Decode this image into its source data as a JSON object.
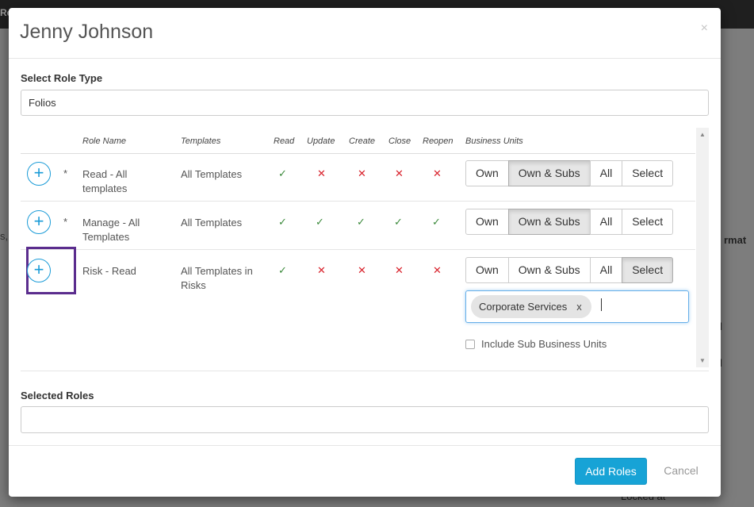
{
  "background": {
    "topbar_text": "Re",
    "fragments": [
      {
        "text": "s, /"
      },
      {
        "text": "rmat"
      },
      {
        "text": "d"
      },
      {
        "text": "d"
      },
      {
        "text": "Locked at"
      }
    ]
  },
  "modal": {
    "title": "Jenny Johnson",
    "close_label": "×",
    "role_type_label": "Select Role Type",
    "role_type_value": "Folios",
    "columns": {
      "role_name": "Role Name",
      "templates": "Templates",
      "read": "Read",
      "update": "Update",
      "create": "Create",
      "close": "Close",
      "reopen": "Reopen",
      "business_units": "Business Units"
    },
    "roles": [
      {
        "asterisk": "*",
        "name": "Read - All templates",
        "templates": "All Templates",
        "perms": {
          "read": "✓",
          "update": "✕",
          "create": "✕",
          "close": "✕",
          "reopen": "✕"
        },
        "bu_options": [
          "Own",
          "Own & Subs",
          "All",
          "Select"
        ],
        "bu_selected": "Own & Subs"
      },
      {
        "asterisk": "*",
        "name": "Manage - All Templates",
        "templates": "All Templates",
        "perms": {
          "read": "✓",
          "update": "✓",
          "create": "✓",
          "close": "✓",
          "reopen": "✓"
        },
        "bu_options": [
          "Own",
          "Own & Subs",
          "All",
          "Select"
        ],
        "bu_selected": "Own & Subs"
      },
      {
        "asterisk": "",
        "name": "Risk - Read",
        "templates": "All Templates in Risks",
        "perms": {
          "read": "✓",
          "update": "✕",
          "create": "✕",
          "close": "✕",
          "reopen": "✕"
        },
        "bu_options": [
          "Own",
          "Own & Subs",
          "All",
          "Select"
        ],
        "bu_selected": "Select",
        "selected_units": [
          {
            "label": "Corporate Services",
            "remove": "x"
          }
        ],
        "include_sub_label": "Include Sub Business Units",
        "include_sub_checked": false
      }
    ],
    "add_icon": "+",
    "selected_roles_label": "Selected Roles",
    "selected_roles_value": "",
    "add_roles_label": "Add Roles",
    "cancel_label": "Cancel"
  },
  "colors": {
    "accent": "#17a3d6",
    "check": "#3c8a3c",
    "cross": "#d9232d",
    "focus_ring": "#5b2d8e"
  }
}
